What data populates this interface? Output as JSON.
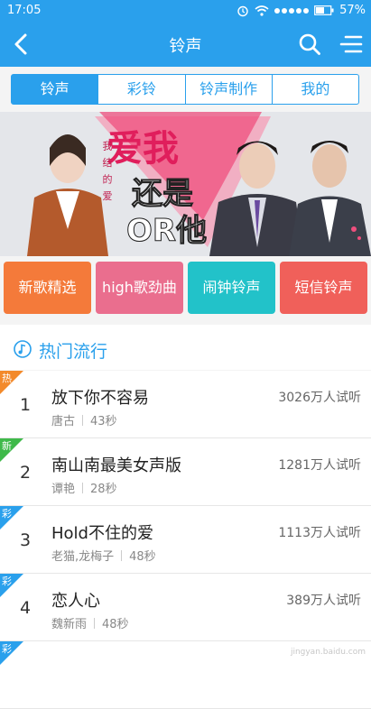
{
  "status": {
    "time": "17:05",
    "battery": "57%"
  },
  "header": {
    "title": "铃声"
  },
  "tabs": [
    "铃声",
    "彩铃",
    "铃声制作",
    "我的"
  ],
  "banner": {
    "headline_1": "爱我",
    "headline_2": "还是",
    "headline_3": "OR他",
    "tagline": "我 结 的 爱"
  },
  "categories": [
    {
      "label": "新歌精选",
      "color": "#f47a3a"
    },
    {
      "label": "high歌劲曲",
      "color": "#ea6e8e"
    },
    {
      "label": "闹钟铃声",
      "color": "#22c2c9"
    },
    {
      "label": "短信铃声",
      "color": "#f0605a"
    }
  ],
  "section": {
    "title": "热门流行"
  },
  "songs": [
    {
      "badge": "热",
      "badge_color": "#f38a2b",
      "rank": "1",
      "name": "放下你不容易",
      "artist": "唐古",
      "duration": "43秒",
      "plays": "3026万人试听"
    },
    {
      "badge": "新",
      "badge_color": "#3fb94a",
      "rank": "2",
      "name": "南山南最美女声版",
      "artist": "谭艳",
      "duration": "28秒",
      "plays": "1281万人试听"
    },
    {
      "badge": "彩",
      "badge_color": "#2aa0ec",
      "rank": "3",
      "name": "Hold不住的爱",
      "artist": "老猫,龙梅子",
      "duration": "48秒",
      "plays": "1113万人试听"
    },
    {
      "badge": "彩",
      "badge_color": "#2aa0ec",
      "rank": "4",
      "name": "恋人心",
      "artist": "魏新雨",
      "duration": "48秒",
      "plays": "389万人试听"
    },
    {
      "badge": "彩",
      "badge_color": "#2aa0ec",
      "rank": "",
      "name": "",
      "artist": "",
      "duration": "",
      "plays": ""
    }
  ],
  "watermark": "jingyan.baidu.com"
}
